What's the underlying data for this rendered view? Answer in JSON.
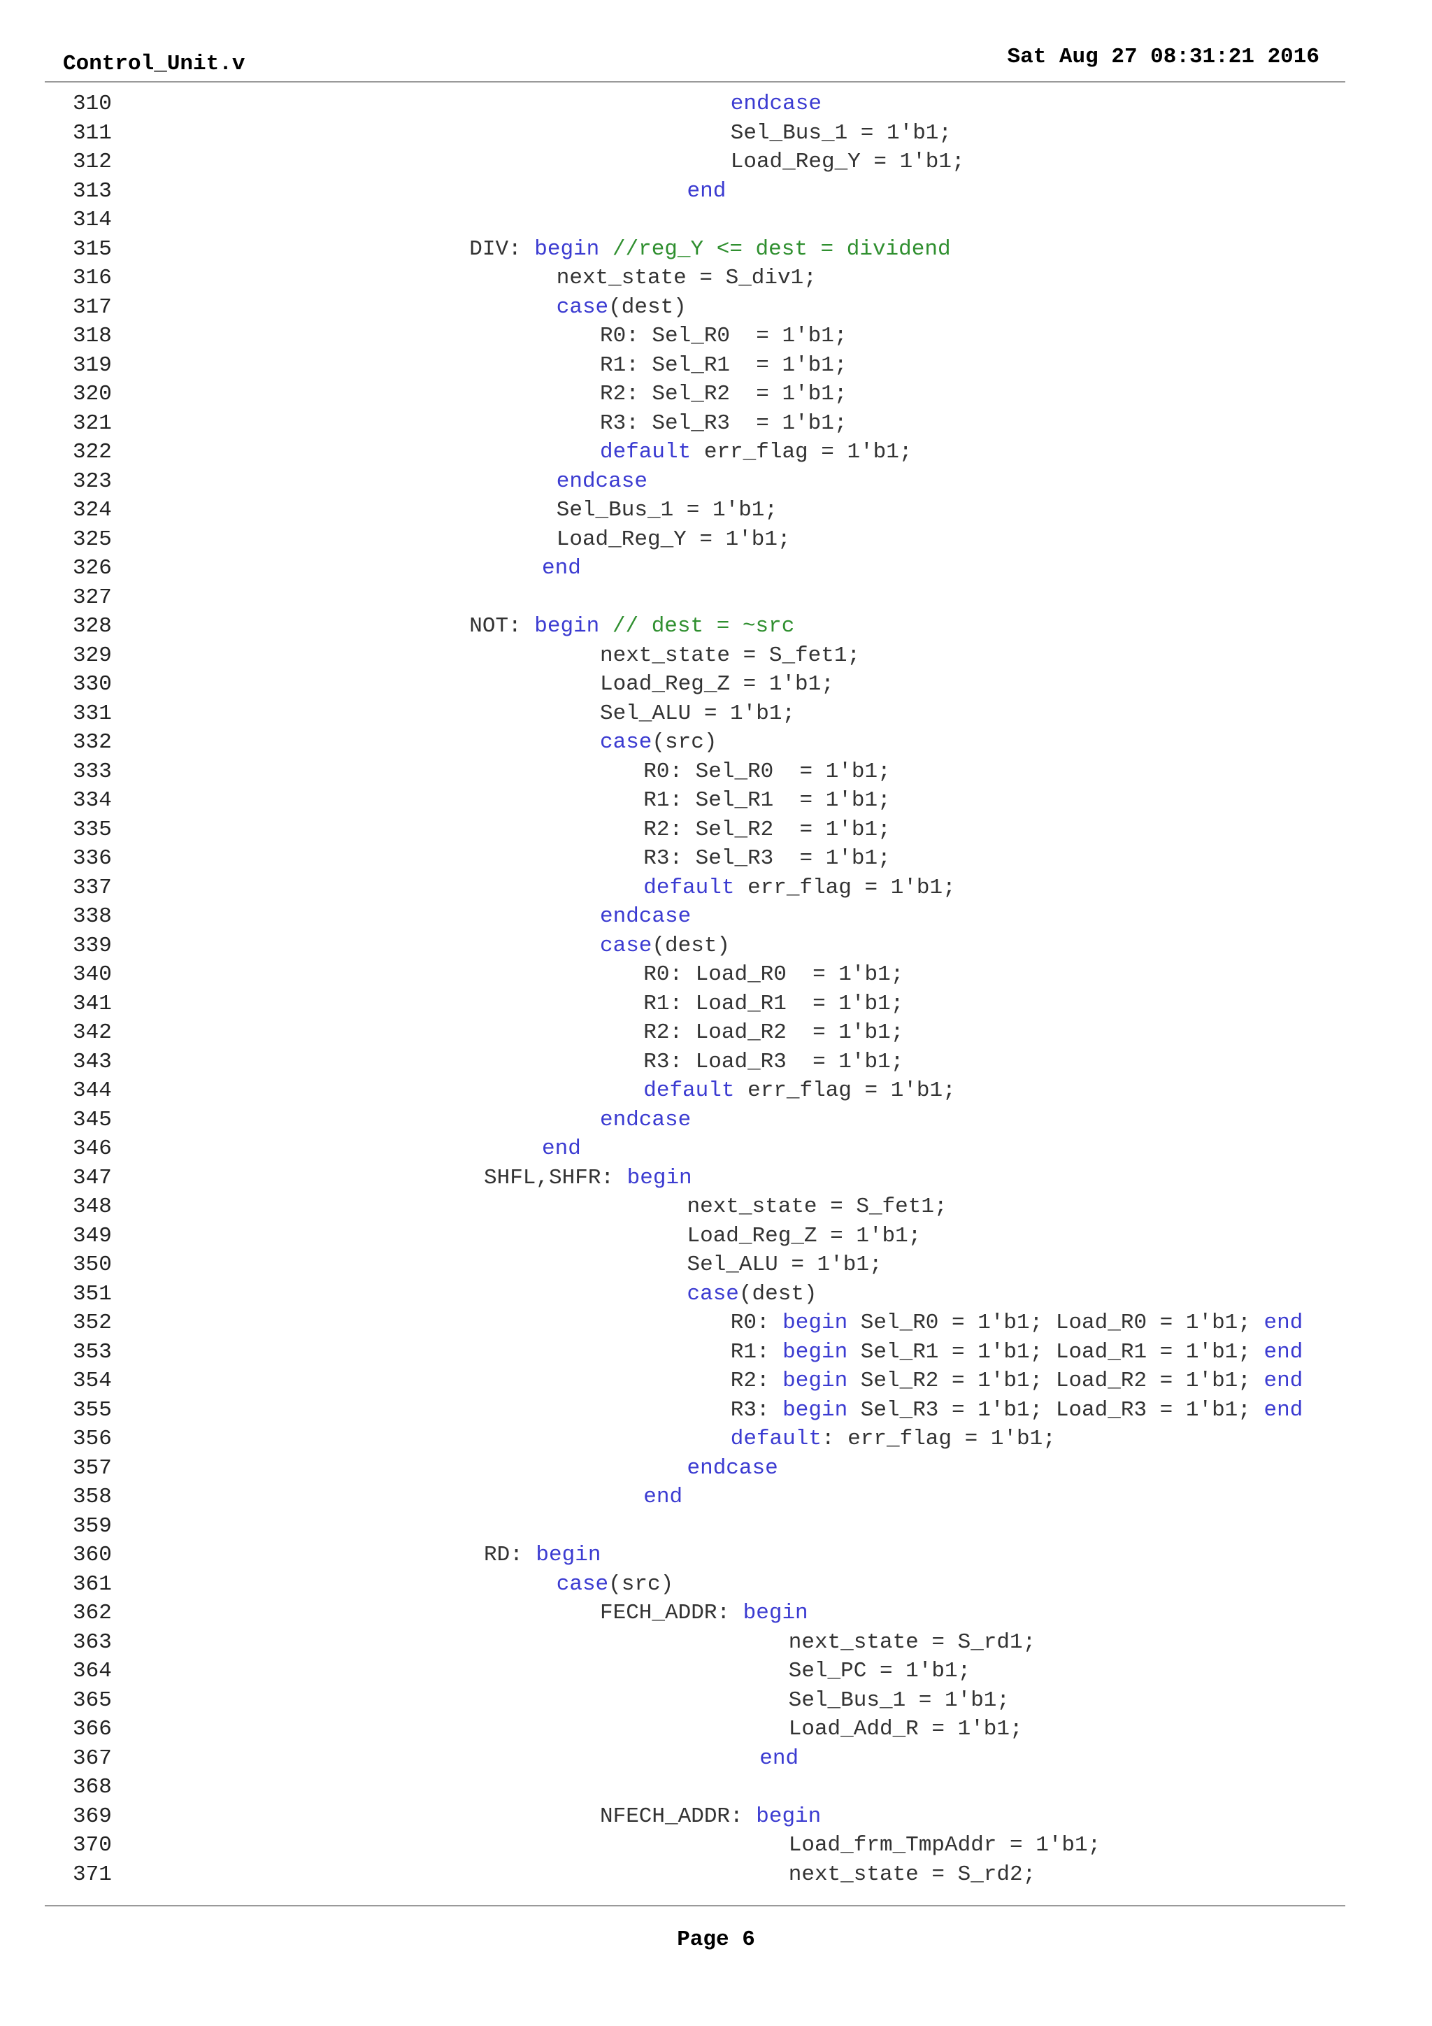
{
  "header": {
    "file_name": "Control_Unit.v",
    "date": "Sat Aug 27 08:31:21 2016"
  },
  "footer": {
    "page_label": "Page 6"
  },
  "lines": [
    {
      "num": "310",
      "indent": 41,
      "segments": [
        {
          "t": "endcase",
          "c": "kw"
        }
      ]
    },
    {
      "num": "311",
      "indent": 41,
      "segments": [
        {
          "t": "Sel_Bus_1 = 1'b1;"
        }
      ]
    },
    {
      "num": "312",
      "indent": 41,
      "segments": [
        {
          "t": "Load_Reg_Y = 1'b1;"
        }
      ]
    },
    {
      "num": "313",
      "indent": 38,
      "segments": [
        {
          "t": "end",
          "c": "kw"
        }
      ]
    },
    {
      "num": "314",
      "indent": 0,
      "segments": []
    },
    {
      "num": "315",
      "indent": 23,
      "segments": [
        {
          "t": "DIV: "
        },
        {
          "t": "begin",
          "c": "kw"
        },
        {
          "t": " "
        },
        {
          "t": "//reg_Y <= dest = dividend",
          "c": "cm"
        }
      ]
    },
    {
      "num": "316",
      "indent": 29,
      "segments": [
        {
          "t": "next_state = S_div1;"
        }
      ]
    },
    {
      "num": "317",
      "indent": 29,
      "segments": [
        {
          "t": "case",
          "c": "kw"
        },
        {
          "t": "(dest)"
        }
      ]
    },
    {
      "num": "318",
      "indent": 32,
      "segments": [
        {
          "t": "R0: Sel_R0  = 1'b1;"
        }
      ]
    },
    {
      "num": "319",
      "indent": 32,
      "segments": [
        {
          "t": "R1: Sel_R1  = 1'b1;"
        }
      ]
    },
    {
      "num": "320",
      "indent": 32,
      "segments": [
        {
          "t": "R2: Sel_R2  = 1'b1;"
        }
      ]
    },
    {
      "num": "321",
      "indent": 32,
      "segments": [
        {
          "t": "R3: Sel_R3  = 1'b1;"
        }
      ]
    },
    {
      "num": "322",
      "indent": 32,
      "segments": [
        {
          "t": "default",
          "c": "kw"
        },
        {
          "t": " err_flag = 1'b1;"
        }
      ]
    },
    {
      "num": "323",
      "indent": 29,
      "segments": [
        {
          "t": "endcase",
          "c": "kw"
        }
      ]
    },
    {
      "num": "324",
      "indent": 29,
      "segments": [
        {
          "t": "Sel_Bus_1 = 1'b1;"
        }
      ]
    },
    {
      "num": "325",
      "indent": 29,
      "segments": [
        {
          "t": "Load_Reg_Y = 1'b1;"
        }
      ]
    },
    {
      "num": "326",
      "indent": 28,
      "segments": [
        {
          "t": "end",
          "c": "kw"
        }
      ]
    },
    {
      "num": "327",
      "indent": 0,
      "segments": []
    },
    {
      "num": "328",
      "indent": 23,
      "segments": [
        {
          "t": "NOT: "
        },
        {
          "t": "begin",
          "c": "kw"
        },
        {
          "t": " "
        },
        {
          "t": "// dest = ~src",
          "c": "cm"
        }
      ]
    },
    {
      "num": "329",
      "indent": 32,
      "segments": [
        {
          "t": "next_state = S_fet1;"
        }
      ]
    },
    {
      "num": "330",
      "indent": 32,
      "segments": [
        {
          "t": "Load_Reg_Z = 1'b1;"
        }
      ]
    },
    {
      "num": "331",
      "indent": 32,
      "segments": [
        {
          "t": "Sel_ALU = 1'b1;"
        }
      ]
    },
    {
      "num": "332",
      "indent": 32,
      "segments": [
        {
          "t": "case",
          "c": "kw"
        },
        {
          "t": "(src)"
        }
      ]
    },
    {
      "num": "333",
      "indent": 35,
      "segments": [
        {
          "t": "R0: Sel_R0  = 1'b1;"
        }
      ]
    },
    {
      "num": "334",
      "indent": 35,
      "segments": [
        {
          "t": "R1: Sel_R1  = 1'b1;"
        }
      ]
    },
    {
      "num": "335",
      "indent": 35,
      "segments": [
        {
          "t": "R2: Sel_R2  = 1'b1;"
        }
      ]
    },
    {
      "num": "336",
      "indent": 35,
      "segments": [
        {
          "t": "R3: Sel_R3  = 1'b1;"
        }
      ]
    },
    {
      "num": "337",
      "indent": 35,
      "segments": [
        {
          "t": "default",
          "c": "kw"
        },
        {
          "t": " err_flag = 1'b1;"
        }
      ]
    },
    {
      "num": "338",
      "indent": 32,
      "segments": [
        {
          "t": "endcase",
          "c": "kw"
        }
      ]
    },
    {
      "num": "339",
      "indent": 32,
      "segments": [
        {
          "t": "case",
          "c": "kw"
        },
        {
          "t": "(dest)"
        }
      ]
    },
    {
      "num": "340",
      "indent": 35,
      "segments": [
        {
          "t": "R0: Load_R0  = 1'b1;"
        }
      ]
    },
    {
      "num": "341",
      "indent": 35,
      "segments": [
        {
          "t": "R1: Load_R1  = 1'b1;"
        }
      ]
    },
    {
      "num": "342",
      "indent": 35,
      "segments": [
        {
          "t": "R2: Load_R2  = 1'b1;"
        }
      ]
    },
    {
      "num": "343",
      "indent": 35,
      "segments": [
        {
          "t": "R3: Load_R3  = 1'b1;"
        }
      ]
    },
    {
      "num": "344",
      "indent": 35,
      "segments": [
        {
          "t": "default",
          "c": "kw"
        },
        {
          "t": " err_flag = 1'b1;"
        }
      ]
    },
    {
      "num": "345",
      "indent": 32,
      "segments": [
        {
          "t": "endcase",
          "c": "kw"
        }
      ]
    },
    {
      "num": "346",
      "indent": 28,
      "segments": [
        {
          "t": "end",
          "c": "kw"
        }
      ]
    },
    {
      "num": "347",
      "indent": 24,
      "segments": [
        {
          "t": "SHFL,SHFR: "
        },
        {
          "t": "begin",
          "c": "kw"
        }
      ]
    },
    {
      "num": "348",
      "indent": 38,
      "segments": [
        {
          "t": "next_state = S_fet1;"
        }
      ]
    },
    {
      "num": "349",
      "indent": 38,
      "segments": [
        {
          "t": "Load_Reg_Z = 1'b1;"
        }
      ]
    },
    {
      "num": "350",
      "indent": 38,
      "segments": [
        {
          "t": "Sel_ALU = 1'b1;"
        }
      ]
    },
    {
      "num": "351",
      "indent": 38,
      "segments": [
        {
          "t": "case",
          "c": "kw"
        },
        {
          "t": "(dest)"
        }
      ]
    },
    {
      "num": "352",
      "indent": 41,
      "segments": [
        {
          "t": "R0: "
        },
        {
          "t": "begin",
          "c": "kw"
        },
        {
          "t": " Sel_R0 = 1'b1; Load_R0 = 1'b1; "
        },
        {
          "t": "end",
          "c": "kw"
        }
      ]
    },
    {
      "num": "353",
      "indent": 41,
      "segments": [
        {
          "t": "R1: "
        },
        {
          "t": "begin",
          "c": "kw"
        },
        {
          "t": " Sel_R1 = 1'b1; Load_R1 = 1'b1; "
        },
        {
          "t": "end",
          "c": "kw"
        }
      ]
    },
    {
      "num": "354",
      "indent": 41,
      "segments": [
        {
          "t": "R2: "
        },
        {
          "t": "begin",
          "c": "kw"
        },
        {
          "t": " Sel_R2 = 1'b1; Load_R2 = 1'b1; "
        },
        {
          "t": "end",
          "c": "kw"
        }
      ]
    },
    {
      "num": "355",
      "indent": 41,
      "segments": [
        {
          "t": "R3: "
        },
        {
          "t": "begin",
          "c": "kw"
        },
        {
          "t": " Sel_R3 = 1'b1; Load_R3 = 1'b1; "
        },
        {
          "t": "end",
          "c": "kw"
        }
      ]
    },
    {
      "num": "356",
      "indent": 41,
      "segments": [
        {
          "t": "default",
          "c": "kw"
        },
        {
          "t": ": err_flag = 1'b1;"
        }
      ]
    },
    {
      "num": "357",
      "indent": 38,
      "segments": [
        {
          "t": "endcase",
          "c": "kw"
        }
      ]
    },
    {
      "num": "358",
      "indent": 35,
      "segments": [
        {
          "t": "end",
          "c": "kw"
        }
      ]
    },
    {
      "num": "359",
      "indent": 0,
      "segments": []
    },
    {
      "num": "360",
      "indent": 24,
      "segments": [
        {
          "t": "RD: "
        },
        {
          "t": "begin",
          "c": "kw"
        }
      ]
    },
    {
      "num": "361",
      "indent": 29,
      "segments": [
        {
          "t": "case",
          "c": "kw"
        },
        {
          "t": "(src)"
        }
      ]
    },
    {
      "num": "362",
      "indent": 32,
      "segments": [
        {
          "t": "FECH_ADDR: "
        },
        {
          "t": "begin",
          "c": "kw"
        }
      ]
    },
    {
      "num": "363",
      "indent": 45,
      "segments": [
        {
          "t": "next_state = S_rd1;"
        }
      ]
    },
    {
      "num": "364",
      "indent": 45,
      "segments": [
        {
          "t": "Sel_PC = 1'b1;"
        }
      ]
    },
    {
      "num": "365",
      "indent": 45,
      "segments": [
        {
          "t": "Sel_Bus_1 = 1'b1;"
        }
      ]
    },
    {
      "num": "366",
      "indent": 45,
      "segments": [
        {
          "t": "Load_Add_R = 1'b1;"
        }
      ]
    },
    {
      "num": "367",
      "indent": 43,
      "segments": [
        {
          "t": "end",
          "c": "kw"
        }
      ]
    },
    {
      "num": "368",
      "indent": 0,
      "segments": []
    },
    {
      "num": "369",
      "indent": 32,
      "segments": [
        {
          "t": "NFECH_ADDR: "
        },
        {
          "t": "begin",
          "c": "kw"
        }
      ]
    },
    {
      "num": "370",
      "indent": 45,
      "segments": [
        {
          "t": "Load_frm_TmpAddr = 1'b1;"
        }
      ]
    },
    {
      "num": "371",
      "indent": 45,
      "segments": [
        {
          "t": "next_state = S_rd2;"
        }
      ]
    }
  ]
}
